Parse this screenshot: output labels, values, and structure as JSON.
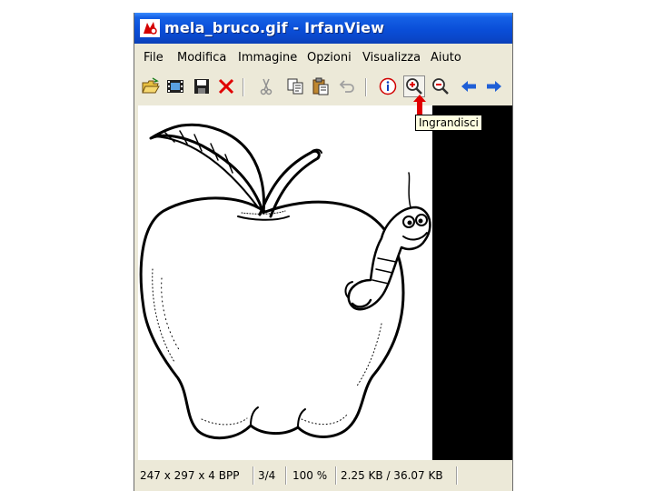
{
  "window": {
    "title": "mela_bruco.gif - IrfanView"
  },
  "menu": [
    "File",
    "Modifica",
    "Immagine",
    "Opzioni",
    "Visualizza",
    "Aiuto"
  ],
  "toolbar": {
    "buttons": [
      {
        "name": "open",
        "icon": "folder-open-icon"
      },
      {
        "name": "slideshow",
        "icon": "film-icon"
      },
      {
        "name": "save",
        "icon": "floppy-icon"
      },
      {
        "name": "delete",
        "icon": "red-x-icon"
      },
      {
        "name": "cut",
        "icon": "scissors-icon"
      },
      {
        "name": "copy",
        "icon": "copy-icon"
      },
      {
        "name": "paste",
        "icon": "paste-icon"
      },
      {
        "name": "undo",
        "icon": "undo-icon"
      },
      {
        "name": "info",
        "icon": "info-icon"
      },
      {
        "name": "zoom-in",
        "icon": "zoom-in-icon"
      },
      {
        "name": "zoom-out",
        "icon": "zoom-out-icon"
      },
      {
        "name": "previous",
        "icon": "arrow-left-icon"
      },
      {
        "name": "next",
        "icon": "arrow-right-icon"
      }
    ],
    "tooltip": "Ingrandisci"
  },
  "status": {
    "dimensions": "247 x 297 x 4 BPP",
    "index": "3/4",
    "zoom": "100 %",
    "size": "2.25 KB / 36.07 KB"
  },
  "colors": {
    "title_bar": "#0a4ed8",
    "chrome": "#ece9d8",
    "tooltip_bg": "#ffffe1",
    "accent_red": "#e00000",
    "arrow_blue": "#1f5fd6"
  }
}
